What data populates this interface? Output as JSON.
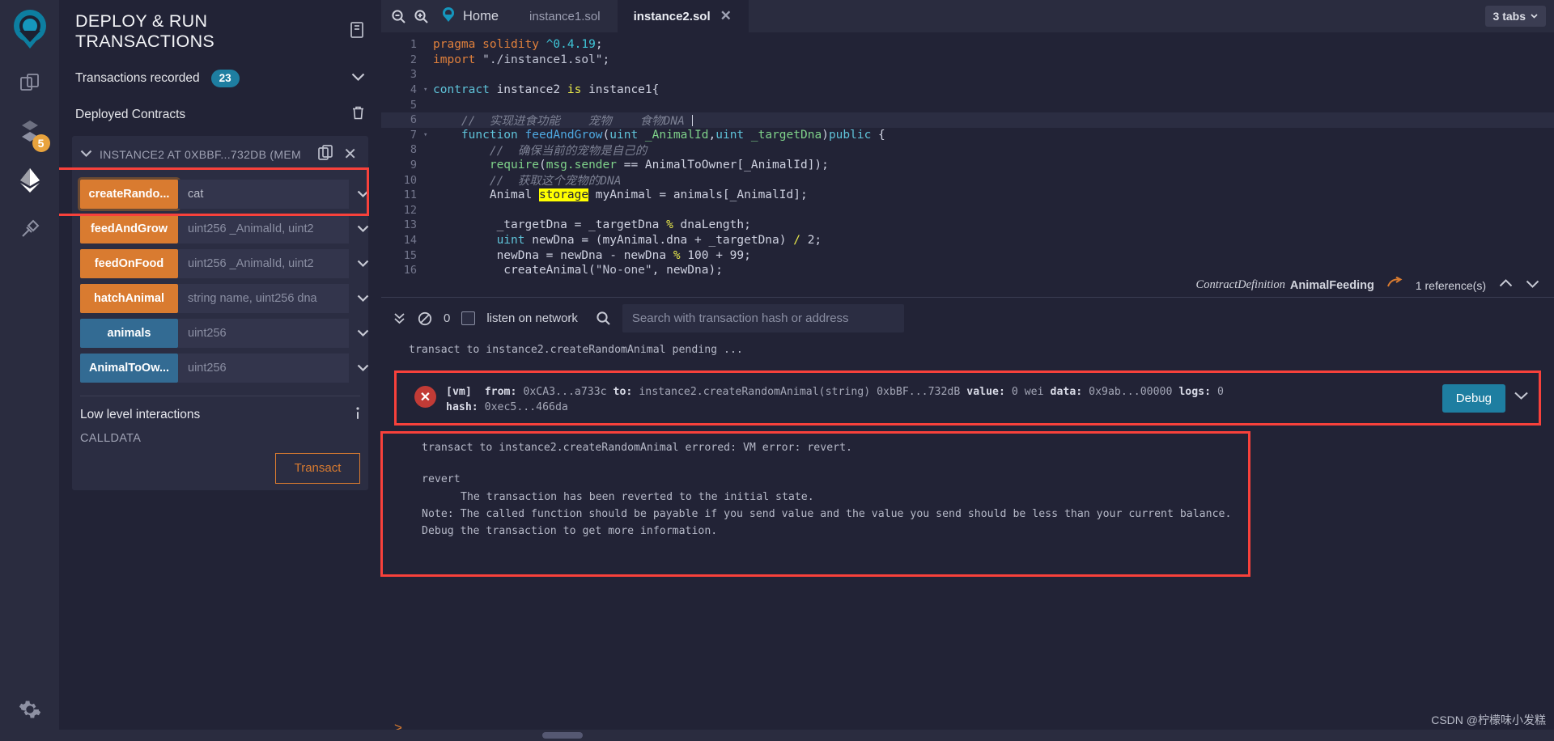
{
  "rail": {
    "logo": "remix-logo-icon",
    "items": [
      {
        "name": "file-explorer-icon",
        "badge": null
      },
      {
        "name": "solidity-compiler-icon",
        "badge": "5"
      },
      {
        "name": "deploy-run-transactions-icon",
        "badge": null
      },
      {
        "name": "plugin-manager-icon",
        "badge": null
      }
    ],
    "settings": "gear-icon"
  },
  "panel": {
    "title": "DEPLOY & RUN TRANSACTIONS",
    "header_icon": "book-icon",
    "transactions_recorded_label": "Transactions recorded",
    "transactions_recorded_count": "23",
    "deployed_contracts_label": "Deployed Contracts",
    "instance_title": "INSTANCE2 AT 0XBBF...732DB (MEM",
    "functions": [
      {
        "label": "createRando...",
        "value": "cat",
        "placeholder": "",
        "kind": "orange",
        "highlighted": true
      },
      {
        "label": "feedAndGrow",
        "value": "",
        "placeholder": "uint256 _AnimalId, uint2",
        "kind": "orange",
        "highlighted": false
      },
      {
        "label": "feedOnFood",
        "value": "",
        "placeholder": "uint256 _AnimalId, uint2",
        "kind": "orange",
        "highlighted": false
      },
      {
        "label": "hatchAnimal",
        "value": "",
        "placeholder": "string name, uint256 dna",
        "kind": "orange",
        "highlighted": false
      },
      {
        "label": "animals",
        "value": "",
        "placeholder": "uint256",
        "kind": "blue",
        "highlighted": false
      },
      {
        "label": "AnimalToOw...",
        "value": "",
        "placeholder": "uint256",
        "kind": "blue",
        "highlighted": false
      }
    ],
    "low_level_label": "Low level interactions",
    "calldata_label": "CALLDATA",
    "calldata_value": "",
    "transact_label": "Transact"
  },
  "tabbar": {
    "zoom_out": "zoom-out-icon",
    "zoom_in": "zoom-in-icon",
    "home_label": "Home",
    "tabs": [
      {
        "label": "instance1.sol",
        "active": false,
        "closable": false
      },
      {
        "label": "instance2.sol",
        "active": true,
        "closable": true
      }
    ],
    "tabs_count_label": "3 tabs"
  },
  "editor": {
    "current_line": 6,
    "lines": [
      {
        "n": "1",
        "fold": false
      },
      {
        "n": "2",
        "fold": false
      },
      {
        "n": "3",
        "fold": false
      },
      {
        "n": "4",
        "fold": true
      },
      {
        "n": "5",
        "fold": false
      },
      {
        "n": "6",
        "fold": false
      },
      {
        "n": "7",
        "fold": true
      },
      {
        "n": "8",
        "fold": false
      },
      {
        "n": "9",
        "fold": false
      },
      {
        "n": "10",
        "fold": false
      },
      {
        "n": "11",
        "fold": false
      },
      {
        "n": "12",
        "fold": false
      },
      {
        "n": "13",
        "fold": false
      },
      {
        "n": "14",
        "fold": false
      },
      {
        "n": "15",
        "fold": false
      },
      {
        "n": "16",
        "fold": false
      }
    ],
    "source": [
      "pragma solidity ^0.4.19;",
      "import \"./instance1.sol\";",
      "",
      "contract instance2 is instance1{",
      "",
      "    //  实现进食功能    宠物    食物DNA",
      "    function feedAndGrow(uint _AnimalId,uint _targetDna)public {",
      "        //  确保当前的宠物是自己的",
      "        require(msg.sender == AnimalToOwner[_AnimalId]);",
      "        //  获取这个宠物的DNA",
      "        Animal storage myAnimal = animals[_AnimalId];",
      "",
      "        _targetDna = _targetDna % dnaLength;",
      "        uint newDna = (myAnimal.dna + _targetDna) / 2;",
      "        newDna = newDna - newDna % 100 + 99;",
      "        _createAnimal(\"No-one\", newDna);"
    ]
  },
  "defbar": {
    "kind": "ContractDefinition",
    "name": "AnimalFeeding",
    "jump_icon": "external-link-icon",
    "references": "1 reference(s)",
    "up_icon": "chevron-up-icon",
    "down_icon": "chevron-down-icon"
  },
  "terminal": {
    "collapse_icon": "double-chevron-down-icon",
    "clear_icon": "no-entry-icon",
    "pending_count": "0",
    "listen_label": "listen on network",
    "listen_checked": false,
    "search_icon": "search-icon",
    "search_placeholder": "Search with transaction hash or address",
    "search_value": "",
    "pending_line": "transact to instance2.createRandomAnimal pending ...",
    "tx": {
      "status_icon": "error-icon",
      "vm_tag": "[vm]",
      "from_label": "from:",
      "from_value": "0xCA3...a733c",
      "to_label": "to:",
      "to_value": "instance2.createRandomAnimal(string) 0xbBF...732dB",
      "value_label": "value:",
      "value_value": "0 wei",
      "data_label": "data:",
      "data_value": "0x9ab...00000",
      "logs_label": "logs:",
      "logs_value": "0",
      "hash_label": "hash:",
      "hash_value": "0xec5...466da",
      "debug_label": "Debug",
      "expand_icon": "chevron-down-icon"
    },
    "error_lines": [
      "transact to instance2.createRandomAnimal errored: VM error: revert.",
      "",
      "revert",
      "\tThe transaction has been reverted to the initial state.",
      "Note: The called function should be payable if you send value and the value you send should be less than your current balance.",
      "Debug the transaction to get more information."
    ],
    "prompt": "&gt;"
  },
  "watermark": "CSDN @柠檬味小发糕",
  "colors": {
    "accent_orange": "#d97b30",
    "accent_blue": "#336b93",
    "badge_blue": "#1e7ea1",
    "highlight_red": "#f8413b",
    "panel_bg": "#222336",
    "rail_bg": "#2a2c3f"
  }
}
